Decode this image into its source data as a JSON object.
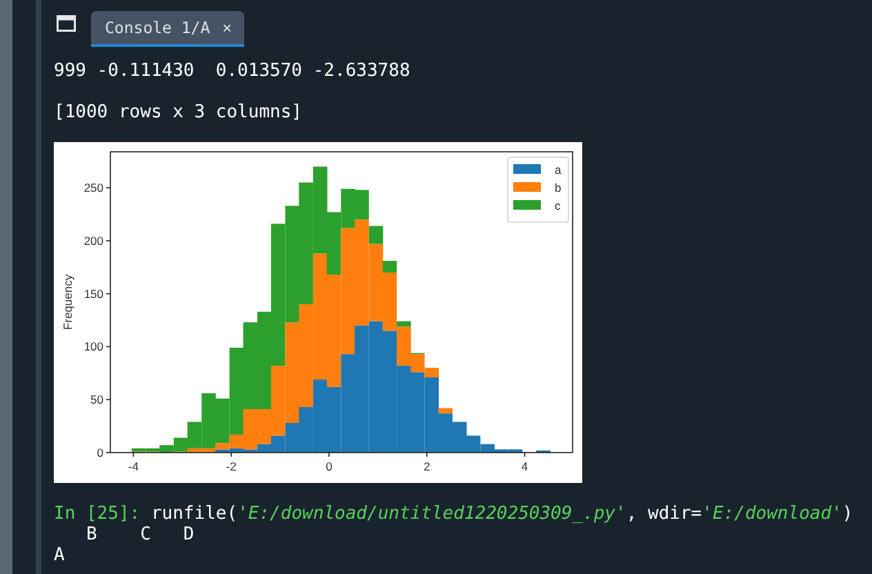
{
  "tab_bar": {
    "tabs": [
      {
        "label": "Console 1/A",
        "close": "×",
        "selected": true
      }
    ]
  },
  "console": {
    "lines_before": [
      "999 -0.111430  0.013570 -2.633788",
      "[1000 rows x 3 columns]"
    ],
    "figure": {
      "chart_data": {
        "type": "bar",
        "stacked": true,
        "ylabel": "Frequency",
        "x": [
          -3.89,
          -3.6,
          -3.32,
          -3.03,
          -2.75,
          -2.46,
          -2.18,
          -1.89,
          -1.61,
          -1.32,
          -1.04,
          -0.75,
          -0.47,
          -0.18,
          0.1,
          0.39,
          0.67,
          0.96,
          1.24,
          1.53,
          1.81,
          2.1,
          2.38,
          2.67,
          2.95,
          3.24,
          3.52,
          3.81,
          4.09,
          4.38
        ],
        "series": [
          {
            "name": "a",
            "color": "#1f77b4",
            "values": [
              0,
              0,
              0,
              0,
              0,
              0,
              3,
              4,
              3,
              8,
              16,
              28,
              43,
              69,
              62,
              93,
              120,
              124,
              115,
              82,
              76,
              71,
              37,
              29,
              16,
              8,
              3,
              3,
              0,
              2
            ]
          },
          {
            "name": "b",
            "color": "#ff7f0e",
            "values": [
              1,
              1,
              0,
              1,
              4,
              4,
              6,
              13,
              38,
              33,
              66,
              95,
              97,
              119,
              106,
              119,
              100,
              73,
              55,
              37,
              17,
              9,
              5,
              0,
              0,
              0,
              0,
              0,
              0,
              0
            ]
          },
          {
            "name": "c",
            "color": "#2ca02c",
            "values": [
              3,
              3,
              7,
              13,
              25,
              52,
              42,
              82,
              82,
              92,
              134,
              110,
              115,
              82,
              59,
              37,
              28,
              17,
              11,
              5,
              1,
              0,
              0,
              0,
              0,
              0,
              0,
              0,
              0,
              0
            ]
          }
        ],
        "legend": "upper right",
        "xlim": [
          -4.47,
          4.98
        ],
        "ylim": [
          0,
          284
        ],
        "xticks": [
          -4,
          -2,
          0,
          2,
          4
        ],
        "yticks": [
          0,
          50,
          100,
          150,
          200,
          250
        ]
      }
    },
    "prompt": {
      "label": "In [25]:",
      "command": [
        {
          "kind": "code",
          "text": " runfile("
        },
        {
          "kind": "string",
          "text": "'E:/download/untitled1220250309_.py'"
        },
        {
          "kind": "code",
          "text": ", wdir="
        },
        {
          "kind": "string",
          "text": "'E:/download'"
        },
        {
          "kind": "code",
          "text": ")"
        }
      ]
    },
    "lines_after": [
      "   B    C   D",
      "A"
    ]
  }
}
